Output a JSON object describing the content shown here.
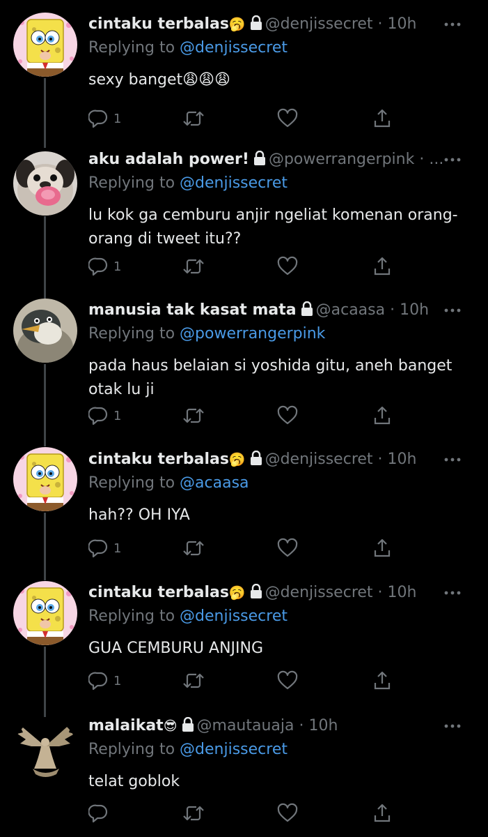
{
  "tweets": [
    {
      "display_name": "cintaku terbalas",
      "name_emoji": "🥱",
      "handle": "@denjissecret",
      "separator": "·",
      "time": "10h",
      "replying_prefix": "Replying to",
      "replying_to": "@denjissecret",
      "text": "sexy banget😩😩😩",
      "reply_count": "1",
      "avatar": "spongebob"
    },
    {
      "display_name": "aku adalah power!",
      "name_emoji": "",
      "handle": "@powerrangerpink",
      "separator": "·",
      "time": "...",
      "replying_prefix": "Replying to",
      "replying_to": "@denjissecret",
      "text": "lu kok ga cemburu anjir ngeliat komenan orang-orang di tweet itu??",
      "reply_count": "1",
      "avatar": "pug"
    },
    {
      "display_name": "manusia tak kasat mata",
      "name_emoji": "",
      "handle": "@acaasa",
      "separator": "·",
      "time": "10h",
      "replying_prefix": "Replying to",
      "replying_to": "@powerrangerpink",
      "text": "pada haus belaian si yoshida gitu, aneh banget otak lu ji",
      "reply_count": "1",
      "avatar": "penguin"
    },
    {
      "display_name": "cintaku terbalas",
      "name_emoji": "🥱",
      "handle": "@denjissecret",
      "separator": "·",
      "time": "10h",
      "replying_prefix": "Replying to",
      "replying_to": "@acaasa",
      "text": "hah?? OH IYA",
      "reply_count": "1",
      "avatar": "spongebob"
    },
    {
      "display_name": "cintaku terbalas",
      "name_emoji": "🥱",
      "handle": "@denjissecret",
      "separator": "·",
      "time": "10h",
      "replying_prefix": "Replying to",
      "replying_to": "@denjissecret",
      "text": "GUA CEMBURU ANJING",
      "reply_count": "1",
      "avatar": "spongebob"
    },
    {
      "display_name": "malaikat",
      "name_emoji": "😎",
      "handle": "@mautauaja",
      "separator": "·",
      "time": "10h",
      "replying_prefix": "Replying to",
      "replying_to": "@denjissecret",
      "text": "telat goblok",
      "reply_count": "",
      "avatar": "angel"
    }
  ],
  "icons": {
    "reply": "reply-icon",
    "retweet": "retweet-icon",
    "like": "heart-icon",
    "share": "share-icon",
    "more": "more-icon",
    "lock": "lock-icon"
  },
  "colors": {
    "background": "#000000",
    "text": "#e7e9ea",
    "secondary": "#71767b",
    "link": "#4a9ae6",
    "thread_line": "#3f4448"
  }
}
